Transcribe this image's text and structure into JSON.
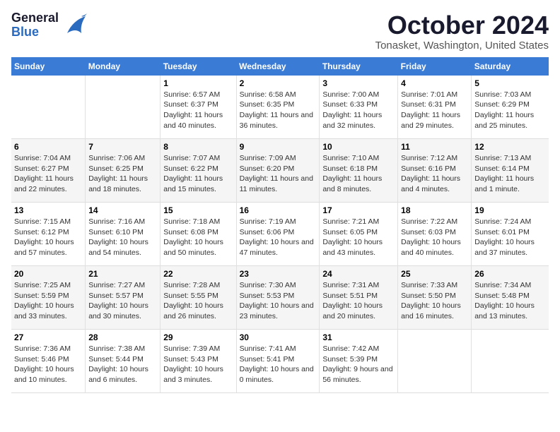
{
  "header": {
    "logo_general": "General",
    "logo_blue": "Blue",
    "month_title": "October 2024",
    "location": "Tonasket, Washington, United States"
  },
  "columns": [
    "Sunday",
    "Monday",
    "Tuesday",
    "Wednesday",
    "Thursday",
    "Friday",
    "Saturday"
  ],
  "weeks": [
    [
      {
        "day": "",
        "info": ""
      },
      {
        "day": "",
        "info": ""
      },
      {
        "day": "1",
        "info": "Sunrise: 6:57 AM\nSunset: 6:37 PM\nDaylight: 11 hours and 40 minutes."
      },
      {
        "day": "2",
        "info": "Sunrise: 6:58 AM\nSunset: 6:35 PM\nDaylight: 11 hours and 36 minutes."
      },
      {
        "day": "3",
        "info": "Sunrise: 7:00 AM\nSunset: 6:33 PM\nDaylight: 11 hours and 32 minutes."
      },
      {
        "day": "4",
        "info": "Sunrise: 7:01 AM\nSunset: 6:31 PM\nDaylight: 11 hours and 29 minutes."
      },
      {
        "day": "5",
        "info": "Sunrise: 7:03 AM\nSunset: 6:29 PM\nDaylight: 11 hours and 25 minutes."
      }
    ],
    [
      {
        "day": "6",
        "info": "Sunrise: 7:04 AM\nSunset: 6:27 PM\nDaylight: 11 hours and 22 minutes."
      },
      {
        "day": "7",
        "info": "Sunrise: 7:06 AM\nSunset: 6:25 PM\nDaylight: 11 hours and 18 minutes."
      },
      {
        "day": "8",
        "info": "Sunrise: 7:07 AM\nSunset: 6:22 PM\nDaylight: 11 hours and 15 minutes."
      },
      {
        "day": "9",
        "info": "Sunrise: 7:09 AM\nSunset: 6:20 PM\nDaylight: 11 hours and 11 minutes."
      },
      {
        "day": "10",
        "info": "Sunrise: 7:10 AM\nSunset: 6:18 PM\nDaylight: 11 hours and 8 minutes."
      },
      {
        "day": "11",
        "info": "Sunrise: 7:12 AM\nSunset: 6:16 PM\nDaylight: 11 hours and 4 minutes."
      },
      {
        "day": "12",
        "info": "Sunrise: 7:13 AM\nSunset: 6:14 PM\nDaylight: 11 hours and 1 minute."
      }
    ],
    [
      {
        "day": "13",
        "info": "Sunrise: 7:15 AM\nSunset: 6:12 PM\nDaylight: 10 hours and 57 minutes."
      },
      {
        "day": "14",
        "info": "Sunrise: 7:16 AM\nSunset: 6:10 PM\nDaylight: 10 hours and 54 minutes."
      },
      {
        "day": "15",
        "info": "Sunrise: 7:18 AM\nSunset: 6:08 PM\nDaylight: 10 hours and 50 minutes."
      },
      {
        "day": "16",
        "info": "Sunrise: 7:19 AM\nSunset: 6:06 PM\nDaylight: 10 hours and 47 minutes."
      },
      {
        "day": "17",
        "info": "Sunrise: 7:21 AM\nSunset: 6:05 PM\nDaylight: 10 hours and 43 minutes."
      },
      {
        "day": "18",
        "info": "Sunrise: 7:22 AM\nSunset: 6:03 PM\nDaylight: 10 hours and 40 minutes."
      },
      {
        "day": "19",
        "info": "Sunrise: 7:24 AM\nSunset: 6:01 PM\nDaylight: 10 hours and 37 minutes."
      }
    ],
    [
      {
        "day": "20",
        "info": "Sunrise: 7:25 AM\nSunset: 5:59 PM\nDaylight: 10 hours and 33 minutes."
      },
      {
        "day": "21",
        "info": "Sunrise: 7:27 AM\nSunset: 5:57 PM\nDaylight: 10 hours and 30 minutes."
      },
      {
        "day": "22",
        "info": "Sunrise: 7:28 AM\nSunset: 5:55 PM\nDaylight: 10 hours and 26 minutes."
      },
      {
        "day": "23",
        "info": "Sunrise: 7:30 AM\nSunset: 5:53 PM\nDaylight: 10 hours and 23 minutes."
      },
      {
        "day": "24",
        "info": "Sunrise: 7:31 AM\nSunset: 5:51 PM\nDaylight: 10 hours and 20 minutes."
      },
      {
        "day": "25",
        "info": "Sunrise: 7:33 AM\nSunset: 5:50 PM\nDaylight: 10 hours and 16 minutes."
      },
      {
        "day": "26",
        "info": "Sunrise: 7:34 AM\nSunset: 5:48 PM\nDaylight: 10 hours and 13 minutes."
      }
    ],
    [
      {
        "day": "27",
        "info": "Sunrise: 7:36 AM\nSunset: 5:46 PM\nDaylight: 10 hours and 10 minutes."
      },
      {
        "day": "28",
        "info": "Sunrise: 7:38 AM\nSunset: 5:44 PM\nDaylight: 10 hours and 6 minutes."
      },
      {
        "day": "29",
        "info": "Sunrise: 7:39 AM\nSunset: 5:43 PM\nDaylight: 10 hours and 3 minutes."
      },
      {
        "day": "30",
        "info": "Sunrise: 7:41 AM\nSunset: 5:41 PM\nDaylight: 10 hours and 0 minutes."
      },
      {
        "day": "31",
        "info": "Sunrise: 7:42 AM\nSunset: 5:39 PM\nDaylight: 9 hours and 56 minutes."
      },
      {
        "day": "",
        "info": ""
      },
      {
        "day": "",
        "info": ""
      }
    ]
  ]
}
